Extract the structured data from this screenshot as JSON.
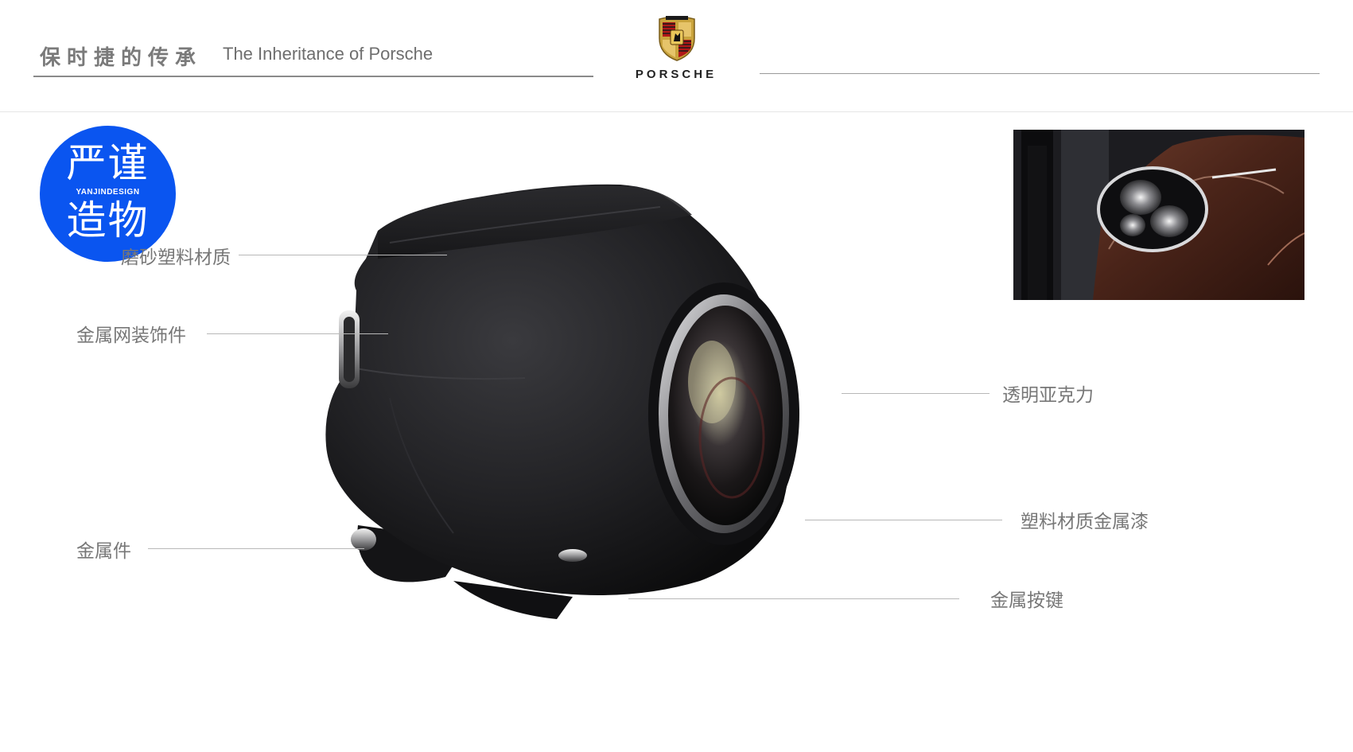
{
  "header": {
    "title_cn": "保时捷的传承",
    "title_en": "The Inheritance of Porsche",
    "brand_wordmark": "PORSCHE"
  },
  "brand_badge": {
    "line1": "严谨",
    "subtitle": "YANJINDESIGN",
    "line2": "造物",
    "color": "#0a55f0"
  },
  "callouts": [
    {
      "label": "磨砂塑料材质"
    },
    {
      "label": "金属网装饰件"
    },
    {
      "label": "金属件"
    },
    {
      "label": "透明亚克力"
    },
    {
      "label": "塑料材质金属漆"
    },
    {
      "label": "金属按键"
    }
  ],
  "colors": {
    "text": "#777777",
    "product_body": "#1c1c1e",
    "car_paint": "#4a2419"
  }
}
